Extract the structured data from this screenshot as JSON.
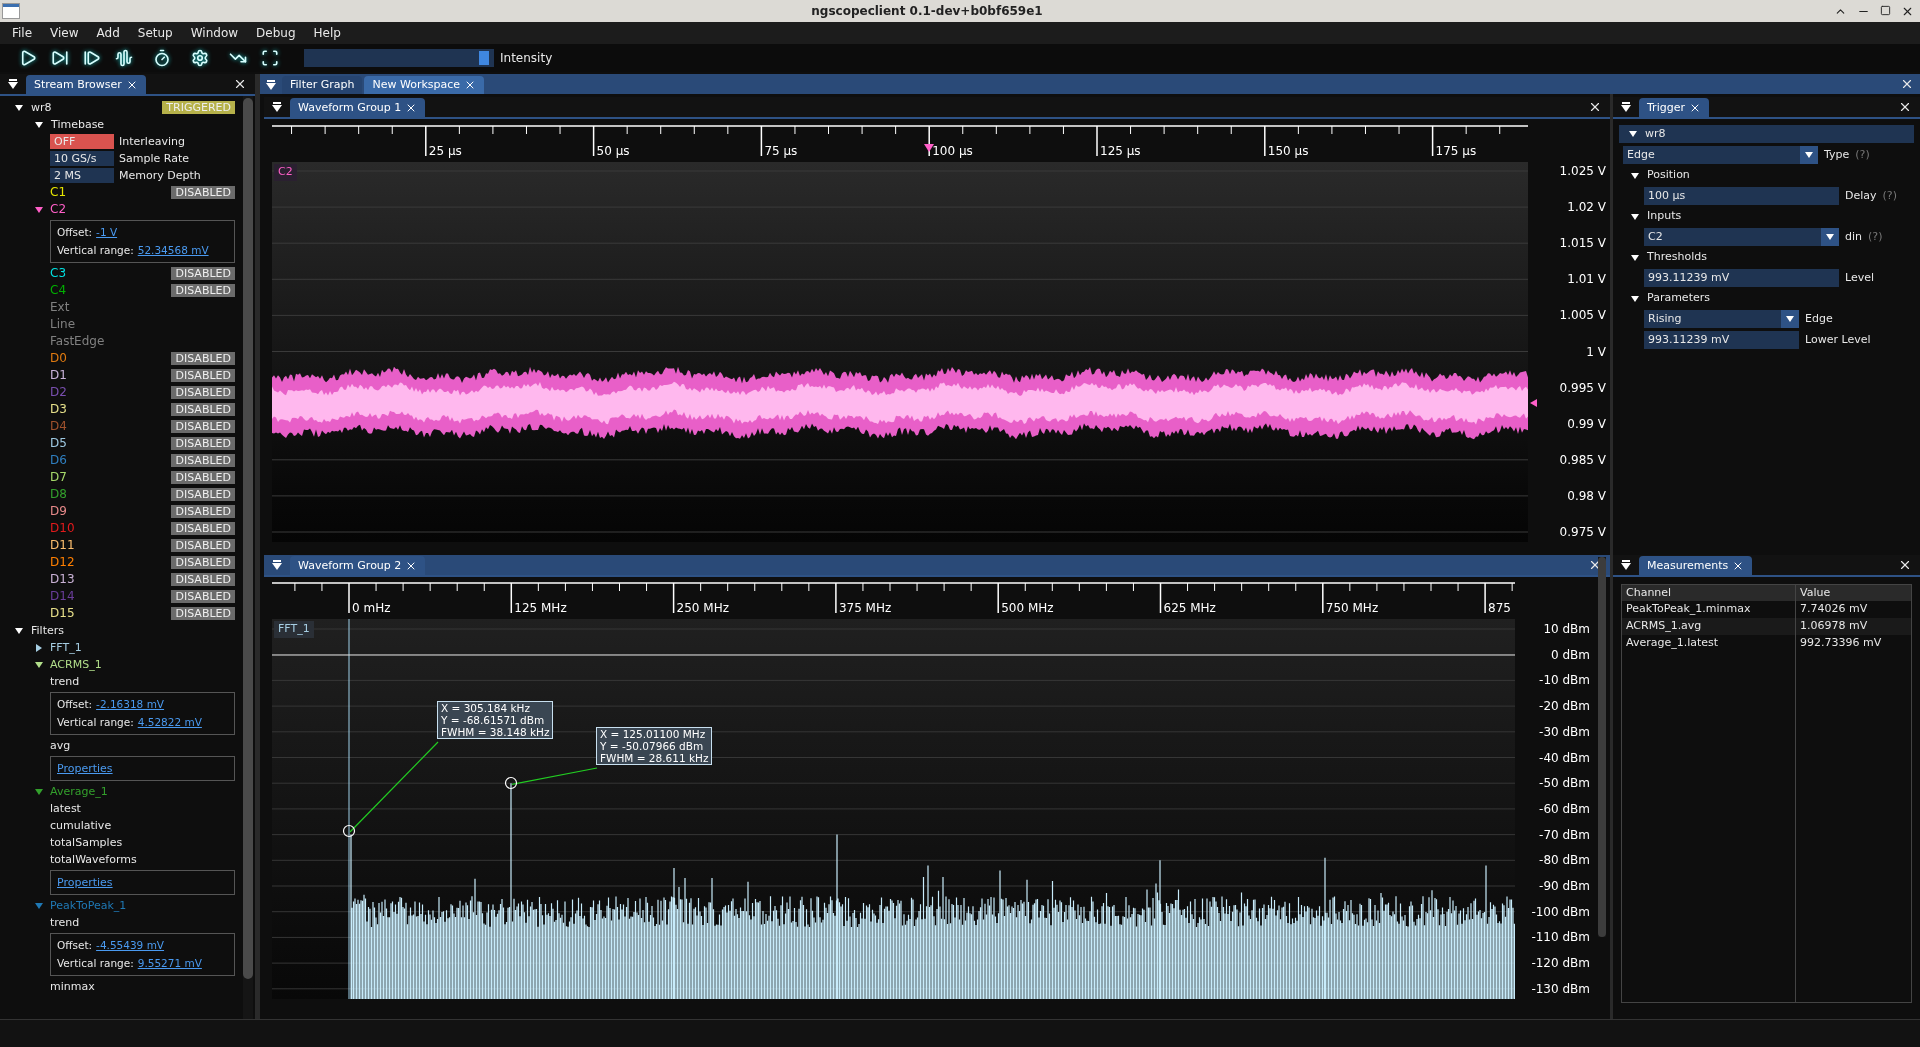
{
  "window": {
    "title": "ngscopeclient 0.1-dev+b0bf659e1"
  },
  "menu": [
    "File",
    "View",
    "Add",
    "Setup",
    "Window",
    "Debug",
    "Help"
  ],
  "toolbar": {
    "intensity": {
      "label": "Intensity",
      "level": 0.97
    }
  },
  "stream_browser": {
    "tab": "Stream Browser",
    "instrument": {
      "name": "wr8",
      "status": "TRIGGERED",
      "expanded": true
    },
    "timebase": {
      "label": "Timebase",
      "expanded": true,
      "rows": [
        {
          "kind": "off",
          "value": "OFF",
          "label": "Interleaving"
        },
        {
          "kind": "value",
          "value": "10 GS/s",
          "label": "Sample Rate"
        },
        {
          "kind": "value",
          "value": "2 MS",
          "label": "Memory Depth"
        }
      ]
    },
    "channels": [
      {
        "name": "C1",
        "color": "#e6e600",
        "expanded": false,
        "status": "DISABLED"
      },
      {
        "name": "C2",
        "color": "#ff5fc8",
        "expanded": true,
        "offset_label": "Offset:",
        "offset": "-1 V",
        "range_label": "Vertical range:",
        "range": "52.34568 mV"
      },
      {
        "name": "C3",
        "color": "#00e0e0",
        "expanded": false,
        "status": "DISABLED"
      },
      {
        "name": "C4",
        "color": "#00b000",
        "expanded": false,
        "status": "DISABLED"
      },
      {
        "name": "Ext",
        "color": "#808080",
        "expanded": false
      },
      {
        "name": "Line",
        "color": "#808080",
        "expanded": false
      },
      {
        "name": "FastEdge",
        "color": "#808080",
        "expanded": false
      },
      {
        "name": "D0",
        "color": "#e07a10",
        "expanded": false,
        "status": "DISABLED"
      },
      {
        "name": "D1",
        "color": "#c9b3d9",
        "expanded": false,
        "status": "DISABLED"
      },
      {
        "name": "D2",
        "color": "#7a4fb0",
        "expanded": false,
        "status": "DISABLED"
      },
      {
        "name": "D3",
        "color": "#e6e08a",
        "expanded": false,
        "status": "DISABLED"
      },
      {
        "name": "D4",
        "color": "#a0522d",
        "expanded": false,
        "status": "DISABLED"
      },
      {
        "name": "D5",
        "color": "#9ec9e2",
        "expanded": false,
        "status": "DISABLED"
      },
      {
        "name": "D6",
        "color": "#2f7fc0",
        "expanded": false,
        "status": "DISABLED"
      },
      {
        "name": "D7",
        "color": "#a6d96a",
        "expanded": false,
        "status": "DISABLED"
      },
      {
        "name": "D8",
        "color": "#33a02c",
        "expanded": false,
        "status": "DISABLED"
      },
      {
        "name": "D9",
        "color": "#e88a8a",
        "expanded": false,
        "status": "DISABLED"
      },
      {
        "name": "D10",
        "color": "#e31a1c",
        "expanded": false,
        "status": "DISABLED"
      },
      {
        "name": "D11",
        "color": "#fdbf6f",
        "expanded": false,
        "status": "DISABLED"
      },
      {
        "name": "D12",
        "color": "#ff7f00",
        "expanded": false,
        "status": "DISABLED"
      },
      {
        "name": "D13",
        "color": "#cab2d6",
        "expanded": false,
        "status": "DISABLED"
      },
      {
        "name": "D14",
        "color": "#6a3d9a",
        "expanded": false,
        "status": "DISABLED"
      },
      {
        "name": "D15",
        "color": "#e8e08a",
        "expanded": false,
        "status": "DISABLED"
      }
    ],
    "filters": {
      "label": "Filters",
      "expanded": true,
      "items": [
        {
          "name": "FFT_1",
          "color": "#a6cee3",
          "expanded": false
        },
        {
          "name": "ACRMS_1",
          "color": "#b2df8a",
          "expanded": true,
          "items": [
            {
              "kind": "stream",
              "name": "trend"
            },
            {
              "kind": "range",
              "offset_label": "Offset:",
              "offset": "-2.16318 mV",
              "range_label": "Vertical range:",
              "range": "4.52822 mV"
            },
            {
              "kind": "stream",
              "name": "avg"
            },
            {
              "kind": "properties",
              "link": "Properties"
            }
          ]
        },
        {
          "name": "Average_1",
          "color": "#33a02c",
          "expanded": true,
          "items": [
            {
              "kind": "stream",
              "name": "latest"
            },
            {
              "kind": "stream",
              "name": "cumulative"
            },
            {
              "kind": "stream",
              "name": "totalSamples"
            },
            {
              "kind": "stream",
              "name": "totalWaveforms"
            },
            {
              "kind": "properties",
              "link": "Properties"
            }
          ]
        },
        {
          "name": "PeakToPeak_1",
          "color": "#1f78b4",
          "expanded": true,
          "items": [
            {
              "kind": "stream",
              "name": "trend"
            },
            {
              "kind": "range",
              "offset_label": "Offset:",
              "offset": "-4.55439 mV",
              "range_label": "Vertical range:",
              "range": "9.55271 mV"
            },
            {
              "kind": "stream",
              "name": "minmax"
            }
          ]
        }
      ]
    }
  },
  "workspace_tabs": [
    {
      "label": "Filter Graph",
      "selected": false
    },
    {
      "label": "New Workspace",
      "selected": true
    }
  ],
  "waveform_group_1": {
    "title": "Waveform Group 1",
    "focused": false,
    "trace": "C2",
    "x_ticks": [
      "25 µs",
      "50 µs",
      "75 µs",
      "100 µs",
      "125 µs",
      "150 µs",
      "175 µs"
    ],
    "y_ticks": [
      "1.025 V",
      "1.02 V",
      "1.015 V",
      "1.01 V",
      "1.005 V",
      "1 V",
      "0.995 V",
      "0.99 V",
      "0.985 V",
      "0.98 V",
      "0.975 V"
    ]
  },
  "waveform_group_2": {
    "title": "Waveform Group 2",
    "focused": true,
    "trace": "FFT_1",
    "x_ticks": [
      "0 mHz",
      "125 MHz",
      "250 MHz",
      "375 MHz",
      "500 MHz",
      "625 MHz",
      "750 MHz",
      "875"
    ],
    "y_ticks": [
      "10 dBm",
      "0 dBm",
      "-10 dBm",
      "-20 dBm",
      "-30 dBm",
      "-40 dBm",
      "-50 dBm",
      "-60 dBm",
      "-70 dBm",
      "-80 dBm",
      "-90 dBm",
      "-100 dBm",
      "-110 dBm",
      "-120 dBm",
      "-130 dBm"
    ],
    "cursors": [
      {
        "lines": [
          "X = 305.184 kHz",
          "Y = -68.61571 dBm",
          "FWHM = 38.148 kHz"
        ]
      },
      {
        "lines": [
          "X = 125.01100 MHz",
          "Y = -50.07966 dBm",
          "FWHM = 28.611 kHz"
        ]
      }
    ]
  },
  "trigger": {
    "tab": "Trigger",
    "instrument": "wr8",
    "type": {
      "value": "Edge",
      "label": "Type",
      "help": "(?)"
    },
    "sections": [
      {
        "label": "Position",
        "expanded": true,
        "fields": [
          {
            "kind": "field",
            "value": "100 µs",
            "label": "Delay",
            "help": "(?)"
          }
        ]
      },
      {
        "label": "Inputs",
        "expanded": true,
        "fields": [
          {
            "kind": "dropdown",
            "value": "C2",
            "label": "din",
            "help": "(?)"
          }
        ]
      },
      {
        "label": "Thresholds",
        "expanded": true,
        "fields": [
          {
            "kind": "field",
            "value": "993.11239 mV",
            "label": "Level"
          }
        ]
      },
      {
        "label": "Parameters",
        "expanded": true,
        "fields": [
          {
            "kind": "dropdown",
            "value": "Rising",
            "label": "Edge"
          },
          {
            "kind": "field",
            "value": "993.11239 mV",
            "label": "Lower Level"
          }
        ]
      }
    ]
  },
  "measurements": {
    "tab": "Measurements",
    "columns": [
      "Channel",
      "Value"
    ],
    "rows": [
      [
        "PeakToPeak_1.minmax",
        "7.74026 mV"
      ],
      [
        "ACRMS_1.avg",
        "1.06978 mV"
      ],
      [
        "Average_1.latest",
        "992.73396 mV"
      ]
    ]
  }
}
